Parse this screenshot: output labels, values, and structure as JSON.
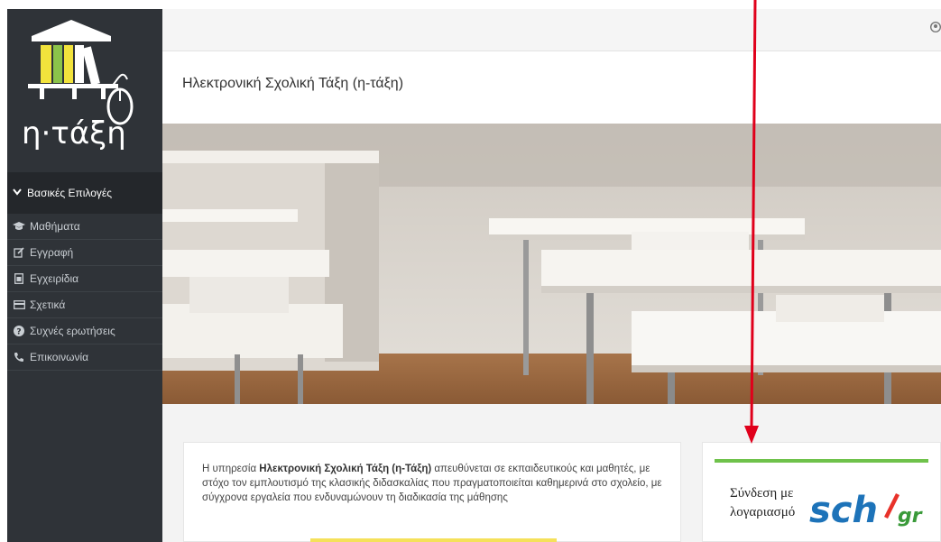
{
  "logo": {
    "text": "η·τάξη"
  },
  "sidebar": {
    "header": {
      "label": "Βασικές Επιλογές",
      "icon": "chevron-down-icon"
    },
    "items": [
      {
        "label": "Μαθήματα",
        "icon": "graduation-cap-icon"
      },
      {
        "label": "Εγγραφή",
        "icon": "edit-icon"
      },
      {
        "label": "Εγχειρίδια",
        "icon": "file-icon"
      },
      {
        "label": "Σχετικά",
        "icon": "card-icon"
      },
      {
        "label": "Συχνές ερωτήσεις",
        "icon": "question-circle-icon"
      },
      {
        "label": "Επικοινωνία",
        "icon": "phone-icon"
      }
    ]
  },
  "topbar": {
    "icon": "user-icon"
  },
  "page": {
    "title": "Ηλεκτρονική Σχολική Τάξη (η-τάξη)"
  },
  "info": {
    "prefix": "Η υπηρεσία ",
    "bold": "Ηλεκτρονική Σχολική Τάξη (η-Τάξη)",
    "suffix": " απευθύνεται σε εκπαιδευτικούς και μαθητές, με στόχο τον εμπλουτισμό της κλασικής διδασκαλίας που πραγματοποιείται καθημερινά στο σχολείο, με σύγχρονα εργαλεία που ενδυναμώνουν τη διαδικασία της μάθησης"
  },
  "login": {
    "label": "Σύνδεση με λογαριασμό",
    "logo_text": "sch",
    "logo_suffix": "gr"
  },
  "colors": {
    "sidebar": "#2f3338",
    "accent_green": "#6fc24b",
    "accent_yellow": "#f5e15a",
    "arrow": "#e0001b",
    "sch_blue": "#1d73b9"
  }
}
